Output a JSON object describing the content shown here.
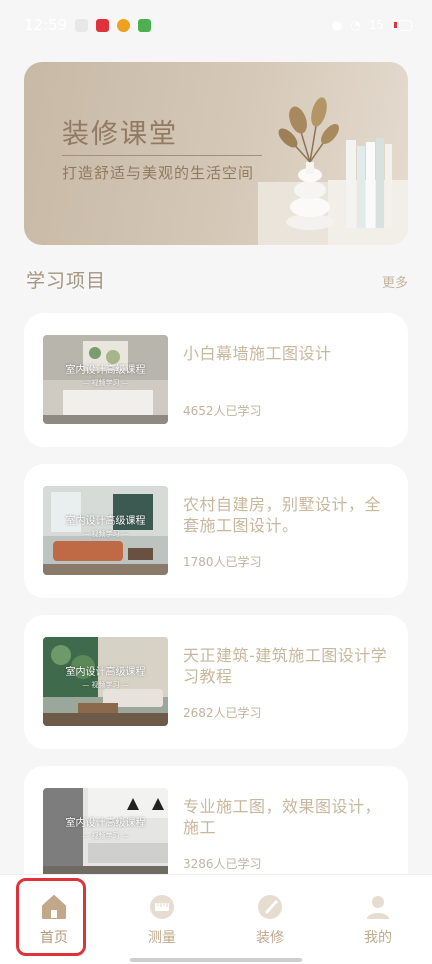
{
  "status_bar": {
    "time": "12:59",
    "battery": "15"
  },
  "banner": {
    "title": "装修课堂",
    "subtitle": "打造舒适与美观的生活空间"
  },
  "section": {
    "title": "学习项目",
    "more": "更多"
  },
  "courses": [
    {
      "thumb_title": "室内设计高级课程",
      "thumb_sub": "— 视频学习 —",
      "title": "小白幕墙施工图设计",
      "count": "4652人已学习"
    },
    {
      "thumb_title": "室内设计高级课程",
      "thumb_sub": "— 视频学习 —",
      "title": "农村自建房，别墅设计，全套施工图设计。",
      "count": "1780人已学习"
    },
    {
      "thumb_title": "室内设计高级课程",
      "thumb_sub": "— 视频学习 —",
      "title": "天正建筑-建筑施工图设计学习教程",
      "count": "2682人已学习"
    },
    {
      "thumb_title": "室内设计高级课程",
      "thumb_sub": "— 视频学习 —",
      "title": "专业施工图，效果图设计，施工",
      "count": "3286人已学习"
    }
  ],
  "nav": {
    "items": [
      {
        "label": "首页",
        "icon": "home-icon"
      },
      {
        "label": "测量",
        "icon": "measure-icon"
      },
      {
        "label": "装修",
        "icon": "brush-icon"
      },
      {
        "label": "我的",
        "icon": "user-icon"
      }
    ],
    "active_index": 0
  },
  "colors": {
    "accent": "#c9b79c",
    "highlight": "#e0323a"
  }
}
